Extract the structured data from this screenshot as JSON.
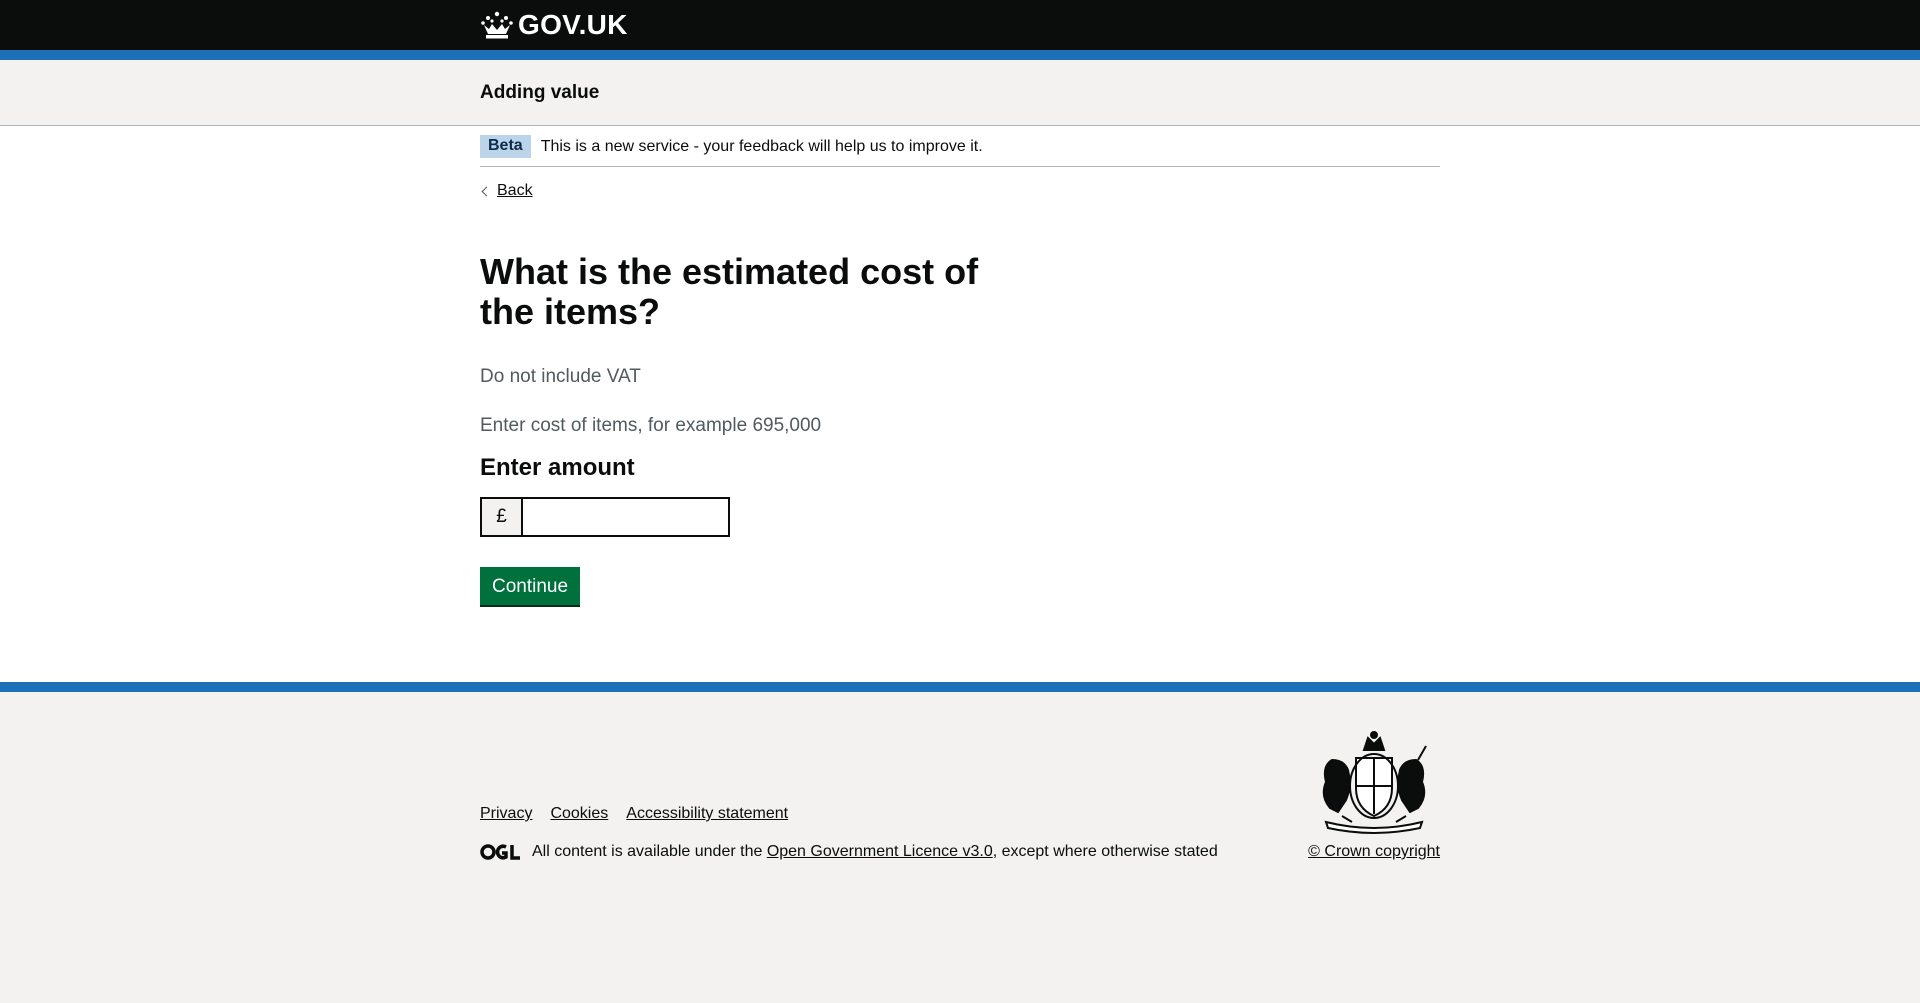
{
  "header": {
    "logo_text": "GOV.UK",
    "service_name": "Adding value",
    "brand_color": "#0b0c0c",
    "stripe_color": "#1d70b8"
  },
  "phase_banner": {
    "tag": "Beta",
    "text": "This is a new service - your feedback will help us to improve it."
  },
  "nav": {
    "back_label": "Back"
  },
  "form": {
    "question": "What is the estimated cost of the items?",
    "hint_vat": "Do not include VAT",
    "hint_example": "Enter cost of items, for example 695,000",
    "label": "Enter amount",
    "currency_prefix": "£",
    "amount_value": "",
    "continue_label": "Continue",
    "button_color": "#00703c"
  },
  "footer": {
    "links": [
      "Privacy",
      "Cookies",
      "Accessibility statement"
    ],
    "licence_prefix": "All content is available under the ",
    "licence_link": "Open Government Licence v3.0",
    "licence_suffix": ", except where otherwise stated",
    "copyright": "© Crown copyright",
    "icons": [
      "crown-icon",
      "ogl-logo",
      "royal-coat-of-arms"
    ]
  }
}
